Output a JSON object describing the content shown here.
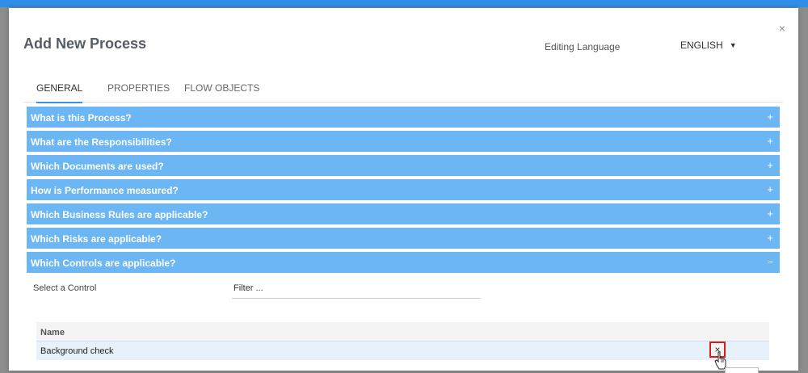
{
  "dialog": {
    "title": "Add New Process",
    "close_symbol": "×",
    "editing_language_label": "Editing Language",
    "language": "ENGLISH"
  },
  "tabs": [
    {
      "label": "GENERAL",
      "active": true
    },
    {
      "label": "PROPERTIES",
      "active": false
    },
    {
      "label": "FLOW OBJECTS",
      "active": false
    }
  ],
  "sections": [
    {
      "label": "What is this Process?",
      "sign": "+"
    },
    {
      "label": "What are the Responsibilities?",
      "sign": "+"
    },
    {
      "label": "Which Documents are used?",
      "sign": "+"
    },
    {
      "label": "How is Performance measured?",
      "sign": "+"
    },
    {
      "label": "Which Business Rules are applicable?",
      "sign": "+"
    },
    {
      "label": "Which Risks are applicable?",
      "sign": "+"
    },
    {
      "label": "Which Controls are applicable?",
      "sign": "−"
    }
  ],
  "controls": {
    "select_label": "Select a Control",
    "filter_placeholder": "Filter ...",
    "table": {
      "header": "Name",
      "rows": [
        {
          "name": "Background check",
          "remove_symbol": "×"
        }
      ]
    }
  },
  "colors": {
    "accent": "#3a93e6",
    "section_bg": "#6cb6f3",
    "highlight": "#e01818"
  }
}
